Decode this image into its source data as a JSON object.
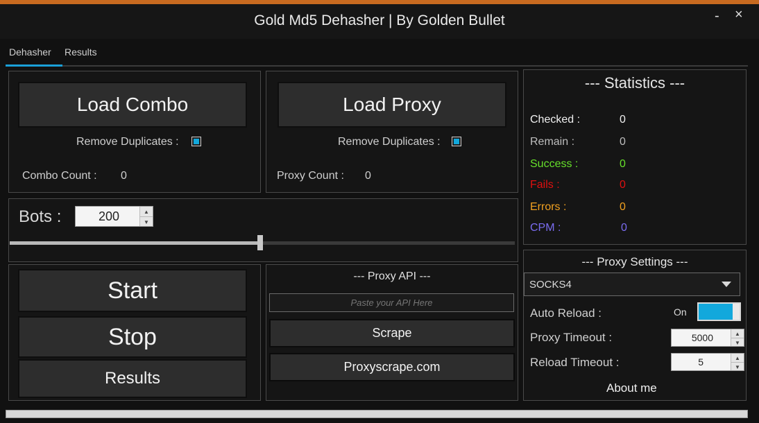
{
  "window": {
    "title": "Gold Md5 Dehasher | By Golden Bullet",
    "minimize_label": "-",
    "close_label": "×"
  },
  "tabs": [
    {
      "label": "Dehasher"
    },
    {
      "label": "Results"
    }
  ],
  "combo": {
    "load_label": "Load Combo",
    "remove_duplicates_label": "Remove Duplicates :",
    "remove_duplicates_checked": true,
    "count_label": "Combo Count :",
    "count_value": "0"
  },
  "proxy": {
    "load_label": "Load Proxy",
    "remove_duplicates_label": "Remove Duplicates :",
    "remove_duplicates_checked": true,
    "count_label": "Proxy Count :",
    "count_value": "0"
  },
  "bots": {
    "label": "Bots :",
    "value": "200",
    "slider_fraction": 0.5
  },
  "actions": {
    "start_label": "Start",
    "stop_label": "Stop",
    "results_label": "Results"
  },
  "proxy_api": {
    "title": "--- Proxy API ---",
    "placeholder": "Paste your API Here",
    "scrape_label": "Scrape",
    "site_label": "Proxyscrape.com"
  },
  "statistics": {
    "title": "--- Statistics ---",
    "rows": [
      {
        "label": "Checked :",
        "value": "0",
        "color": "#f0f0f0"
      },
      {
        "label": "Remain :",
        "value": "0",
        "color": "#bdbdbd"
      },
      {
        "label": "Success :",
        "value": "0",
        "color": "#66e02a"
      },
      {
        "label": "Fails :",
        "value": "0",
        "color": "#e01010"
      },
      {
        "label": "Errors :",
        "value": "0",
        "color": "#f0a020"
      },
      {
        "label": "CPM :",
        "value": "0",
        "color": "#7a6cf0"
      }
    ]
  },
  "proxy_settings": {
    "title": "--- Proxy Settings ---",
    "proxy_type": "SOCKS4",
    "auto_reload_label": "Auto Reload :",
    "auto_reload_state": "On",
    "proxy_timeout_label": "Proxy Timeout :",
    "proxy_timeout_value": "5000",
    "reload_timeout_label": "Reload Timeout :",
    "reload_timeout_value": "5",
    "about_label": "About me"
  },
  "colors": {
    "accent": "#12a8dc",
    "title_strip": "#c86a20"
  }
}
